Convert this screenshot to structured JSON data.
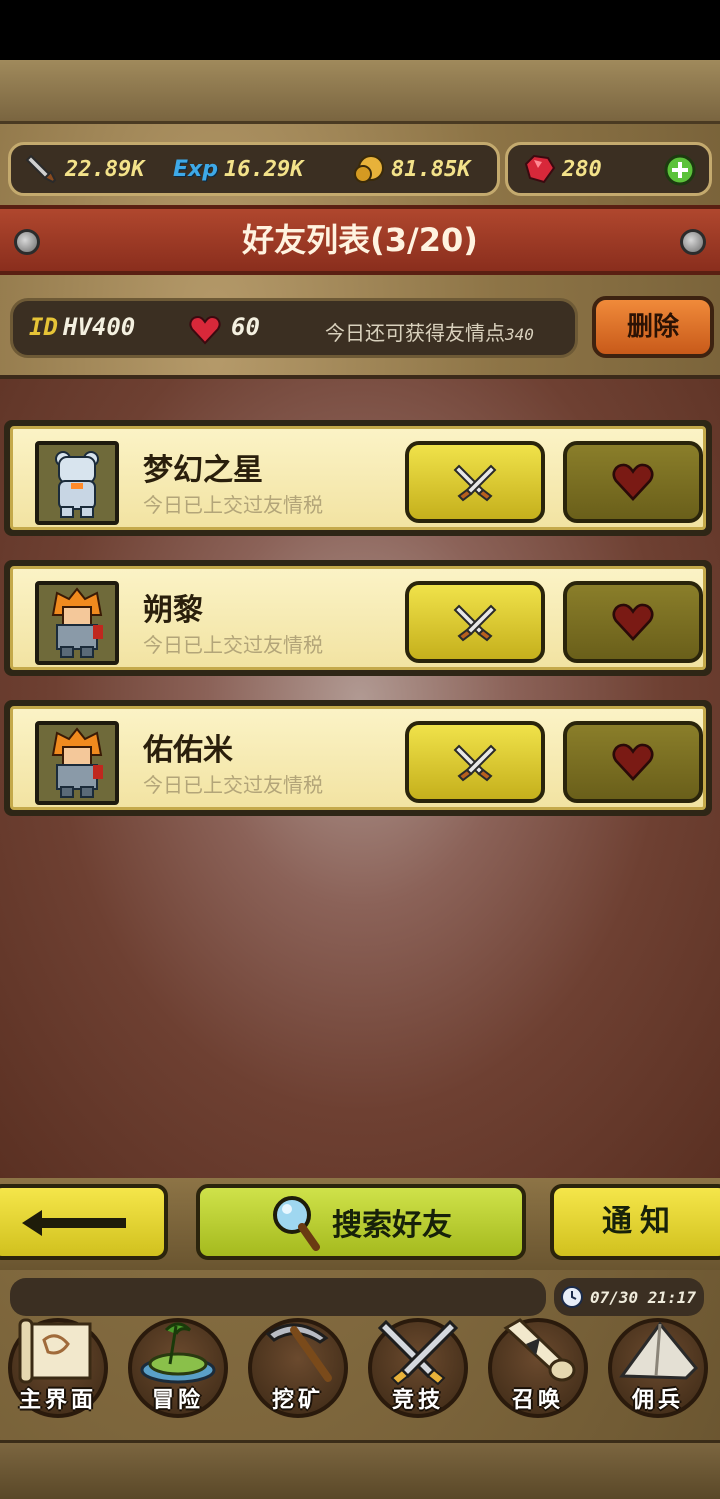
{
  "resources": {
    "attack": "22.89K",
    "exp_icon_text": "Exp",
    "exp": "16.29K",
    "gold": "81.85K",
    "gems": "280"
  },
  "header": {
    "title": "好友列表(3/20)"
  },
  "account": {
    "id_label": "ID",
    "id_value": "HV400",
    "hearts": "60",
    "today_label": "今日还可获得友情点",
    "today_value": "340",
    "delete_label": "删除"
  },
  "friends": [
    {
      "name": "梦幻之星",
      "status": "今日已上交过友情税",
      "avatar": "bear-avatar"
    },
    {
      "name": "朔黎",
      "status": "今日已上交过友情税",
      "avatar": "warrior-avatar"
    },
    {
      "name": "佑佑米",
      "status": "今日已上交过友情税",
      "avatar": "warrior-avatar"
    }
  ],
  "actions": {
    "search_label": "搜索好友",
    "notify_label": "通知"
  },
  "clock": {
    "datetime": "07/30 21:17"
  },
  "nav": [
    {
      "label": "主界面",
      "icon": "map-scroll-icon"
    },
    {
      "label": "冒险",
      "icon": "island-icon"
    },
    {
      "label": "挖矿",
      "icon": "pickaxe-icon"
    },
    {
      "label": "竞技",
      "icon": "crossed-swords-icon"
    },
    {
      "label": "召唤",
      "icon": "summon-scroll-icon"
    },
    {
      "label": "佣兵",
      "icon": "tent-icon"
    }
  ],
  "colors": {
    "banner": "#b0472e",
    "gold_text": "#f3e28a",
    "fight_button": "#f0e24a",
    "heart": "#c0281e"
  }
}
